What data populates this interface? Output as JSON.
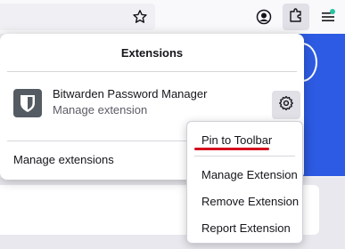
{
  "panel": {
    "title": "Extensions",
    "extension": {
      "name": "Bitwarden Password Manager",
      "subtitle": "Manage extension"
    },
    "manage_link": "Manage extensions"
  },
  "context_menu": {
    "items": [
      {
        "label": "Pin to Toolbar"
      },
      {
        "label": "Manage Extension"
      },
      {
        "label": "Remove Extension"
      },
      {
        "label": "Report Extension"
      }
    ]
  },
  "colors": {
    "accent": "#2d5be3",
    "annotation": "#d50f1e",
    "notification_dot": "#2ac3a2"
  },
  "icons": [
    "star-icon",
    "account-icon",
    "puzzle-icon",
    "menu-icon",
    "bitwarden-shield-icon",
    "gear-icon"
  ]
}
